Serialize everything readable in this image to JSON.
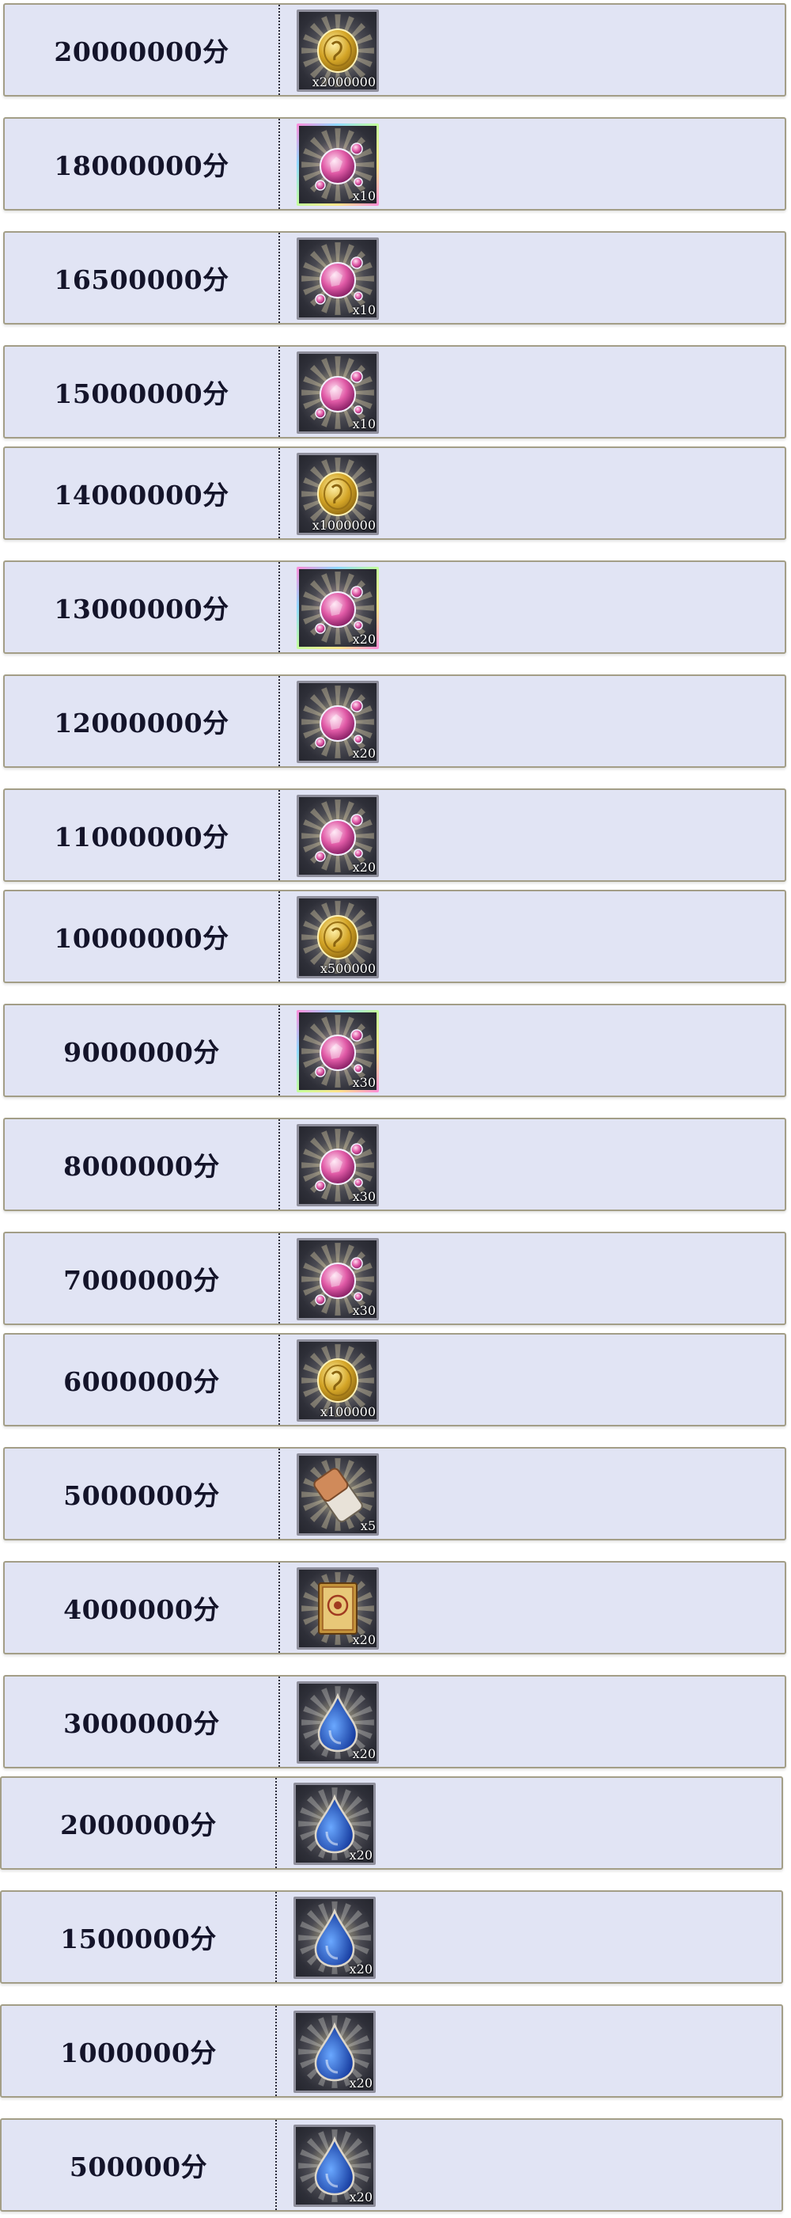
{
  "rewards": [
    {
      "score": "20000000分",
      "item_icon": "gold-coin-icon",
      "quantity": "x2000000"
    },
    {
      "score": "18000000分",
      "item_icon": "pink-crystal-orb-icon",
      "quantity": "x10"
    },
    {
      "score": "16500000分",
      "item_icon": "blue-crystal-orb-icon",
      "quantity": "x10"
    },
    {
      "score": "15000000分",
      "item_icon": "dark-crystal-orb-icon",
      "quantity": "x10"
    },
    {
      "score": "14000000分",
      "item_icon": "gold-coin-icon",
      "quantity": "x1000000"
    },
    {
      "score": "13000000分",
      "item_icon": "pink-crystal-orb-icon",
      "quantity": "x20"
    },
    {
      "score": "12000000分",
      "item_icon": "blue-crystal-orb-icon",
      "quantity": "x20"
    },
    {
      "score": "11000000分",
      "item_icon": "dark-crystal-orb-icon",
      "quantity": "x20"
    },
    {
      "score": "10000000分",
      "item_icon": "gold-coin-icon",
      "quantity": "x500000"
    },
    {
      "score": "9000000分",
      "item_icon": "pink-crystal-orb-icon",
      "quantity": "x30"
    },
    {
      "score": "8000000分",
      "item_icon": "blue-crystal-orb-icon",
      "quantity": "x30"
    },
    {
      "score": "7000000分",
      "item_icon": "dark-crystal-orb-icon",
      "quantity": "x30"
    },
    {
      "score": "6000000分",
      "item_icon": "gold-coin-icon",
      "quantity": "x100000"
    },
    {
      "score": "5000000分",
      "item_icon": "bandage-ticket-icon",
      "quantity": "x5"
    },
    {
      "score": "4000000分",
      "item_icon": "rune-card-icon",
      "quantity": "x20"
    },
    {
      "score": "3000000分",
      "item_icon": "blue-droplet-icon",
      "quantity": "x20"
    },
    {
      "score": "2000000分",
      "item_icon": "green-droplet-icon",
      "quantity": "x20"
    },
    {
      "score": "1500000分",
      "item_icon": "purple-droplet-icon",
      "quantity": "x20"
    },
    {
      "score": "1000000分",
      "item_icon": "yellow-droplet-icon",
      "quantity": "x20"
    },
    {
      "score": "500000分",
      "item_icon": "red-droplet-icon",
      "quantity": "x20"
    }
  ],
  "colors": {
    "row_background": "#e1e4f4",
    "row_border": "#a39e87",
    "score_text": "#14142a"
  }
}
